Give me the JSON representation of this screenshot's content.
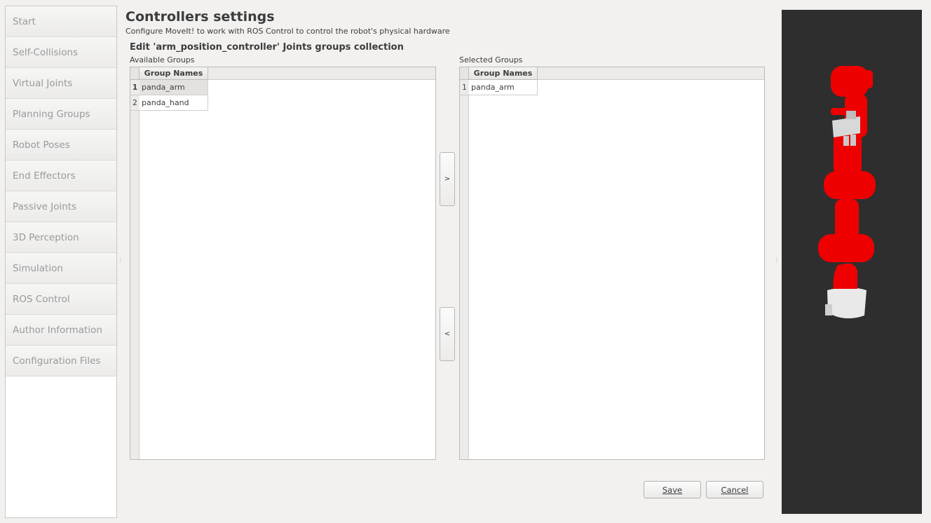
{
  "sidebar": {
    "items": [
      {
        "label": "Start"
      },
      {
        "label": "Self-Collisions"
      },
      {
        "label": "Virtual Joints"
      },
      {
        "label": "Planning Groups"
      },
      {
        "label": "Robot Poses"
      },
      {
        "label": "End Effectors"
      },
      {
        "label": "Passive Joints"
      },
      {
        "label": "3D Perception"
      },
      {
        "label": "Simulation"
      },
      {
        "label": "ROS Control"
      },
      {
        "label": "Author Information"
      },
      {
        "label": "Configuration Files"
      }
    ]
  },
  "header": {
    "title": "Controllers settings",
    "subtitle": "Configure MoveIt! to work with ROS Control to control the robot's physical hardware"
  },
  "editor": {
    "section_title": "Edit 'arm_position_controller' Joints groups collection",
    "available": {
      "label": "Available Groups",
      "column_header": "Group Names",
      "rows": [
        {
          "num": "1",
          "name": "panda_arm"
        },
        {
          "num": "2",
          "name": "panda_hand"
        }
      ]
    },
    "selected": {
      "label": "Selected Groups",
      "column_header": "Group Names",
      "rows": [
        {
          "num": "1",
          "name": "panda_arm"
        }
      ]
    },
    "add_label": ">",
    "remove_label": "<"
  },
  "buttons": {
    "save": "Save",
    "cancel": "Cancel"
  },
  "viewer": {
    "background": "#2e2e2e",
    "robot_color": "#ee0000",
    "gripper_color": "#d8d8d8"
  }
}
